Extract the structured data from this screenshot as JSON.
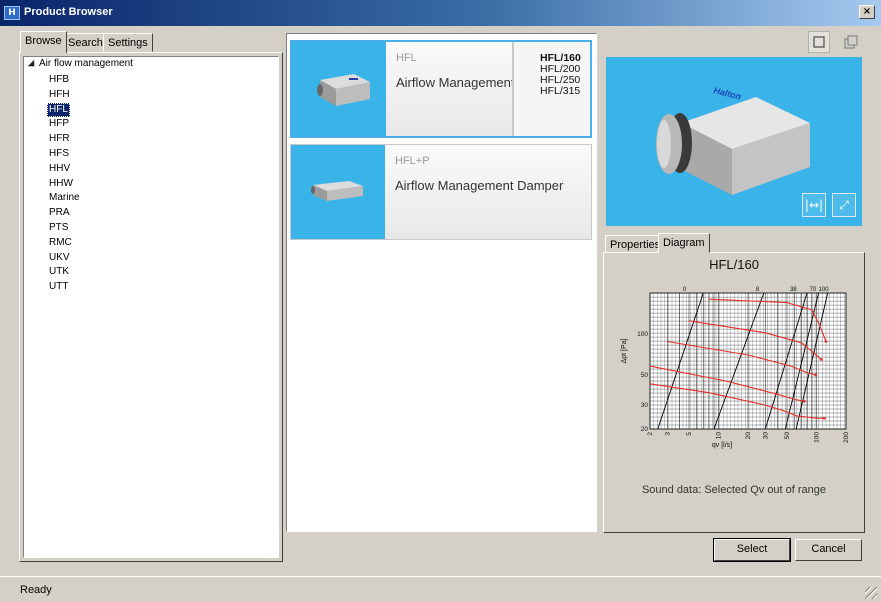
{
  "window": {
    "title": "Product Browser",
    "close_icon": "×"
  },
  "left": {
    "tabs": [
      "Browse",
      "Search",
      "Settings"
    ],
    "active_tab": 0,
    "tree": {
      "root": "Air flow management",
      "items": [
        "HFB",
        "HFH",
        "HFL",
        "HFP",
        "HFR",
        "HFS",
        "HHV",
        "HHW",
        "Marine",
        "PRA",
        "PTS",
        "RMC",
        "UKV",
        "UTK",
        "UTT"
      ],
      "selected": "HFL"
    }
  },
  "products": [
    {
      "code": "HFL",
      "name": "Airflow Management",
      "sizes": [
        "HFL/160",
        "HFL/200",
        "HFL/250",
        "HFL/315"
      ],
      "selected_size": "HFL/160",
      "selected": true
    },
    {
      "code": "HFL+P",
      "name": "Airflow Management Damper",
      "selected": false
    }
  ],
  "preview": {
    "brand": "Halton"
  },
  "right": {
    "tabs": [
      "Properties",
      "Diagram"
    ],
    "active_tab": 1,
    "diagram": {
      "title": "HFL/160",
      "sound_note": "Sound data: Selected Qv out of range"
    }
  },
  "chart_data": {
    "type": "line",
    "title": "HFL/160",
    "xlabel": "qv [l/s]",
    "ylabel": "Δpt [Pa]",
    "xscale": "log",
    "yscale": "log",
    "xlim": [
      2,
      200
    ],
    "ylim": [
      20,
      200
    ],
    "xticks": [
      2,
      3,
      5,
      10,
      20,
      30,
      50,
      100,
      200
    ],
    "yticks": [
      20,
      30,
      50,
      100
    ],
    "top_labels": [
      "0",
      "8",
      "38",
      "70",
      "100"
    ],
    "grid": true,
    "series": [
      {
        "color": "#000000",
        "x": [
          2.4,
          7
        ],
        "y": [
          20,
          200
        ]
      },
      {
        "color": "#000000",
        "x": [
          9,
          29
        ],
        "y": [
          20,
          200
        ]
      },
      {
        "color": "#000000",
        "x": [
          30,
          80
        ],
        "y": [
          20,
          200
        ]
      },
      {
        "color": "#000000",
        "x": [
          48,
          105
        ],
        "y": [
          20,
          200
        ]
      },
      {
        "color": "#000000",
        "x": [
          62,
          130
        ],
        "y": [
          20,
          200
        ]
      },
      {
        "color": "#e8302a",
        "x": [
          8,
          50,
          90,
          108,
          125
        ],
        "y": [
          180,
          170,
          150,
          115,
          88
        ]
      },
      {
        "color": "#e8302a",
        "x": [
          5,
          30,
          70,
          95,
          112
        ],
        "y": [
          125,
          102,
          86,
          72,
          65
        ]
      },
      {
        "color": "#e8302a",
        "x": [
          3,
          20,
          55,
          80,
          98
        ],
        "y": [
          88,
          70,
          58,
          52,
          50
        ]
      },
      {
        "color": "#e8302a",
        "x": [
          2,
          12,
          40,
          60,
          75
        ],
        "y": [
          58,
          45,
          36,
          33,
          32
        ]
      },
      {
        "color": "#e8302a",
        "x": [
          2,
          8,
          30,
          48,
          62,
          100,
          120
        ],
        "y": [
          43,
          37,
          30,
          27,
          25,
          24,
          24
        ]
      }
    ]
  },
  "buttons": {
    "select": "Select",
    "cancel": "Cancel"
  },
  "status": {
    "text": "Ready"
  }
}
